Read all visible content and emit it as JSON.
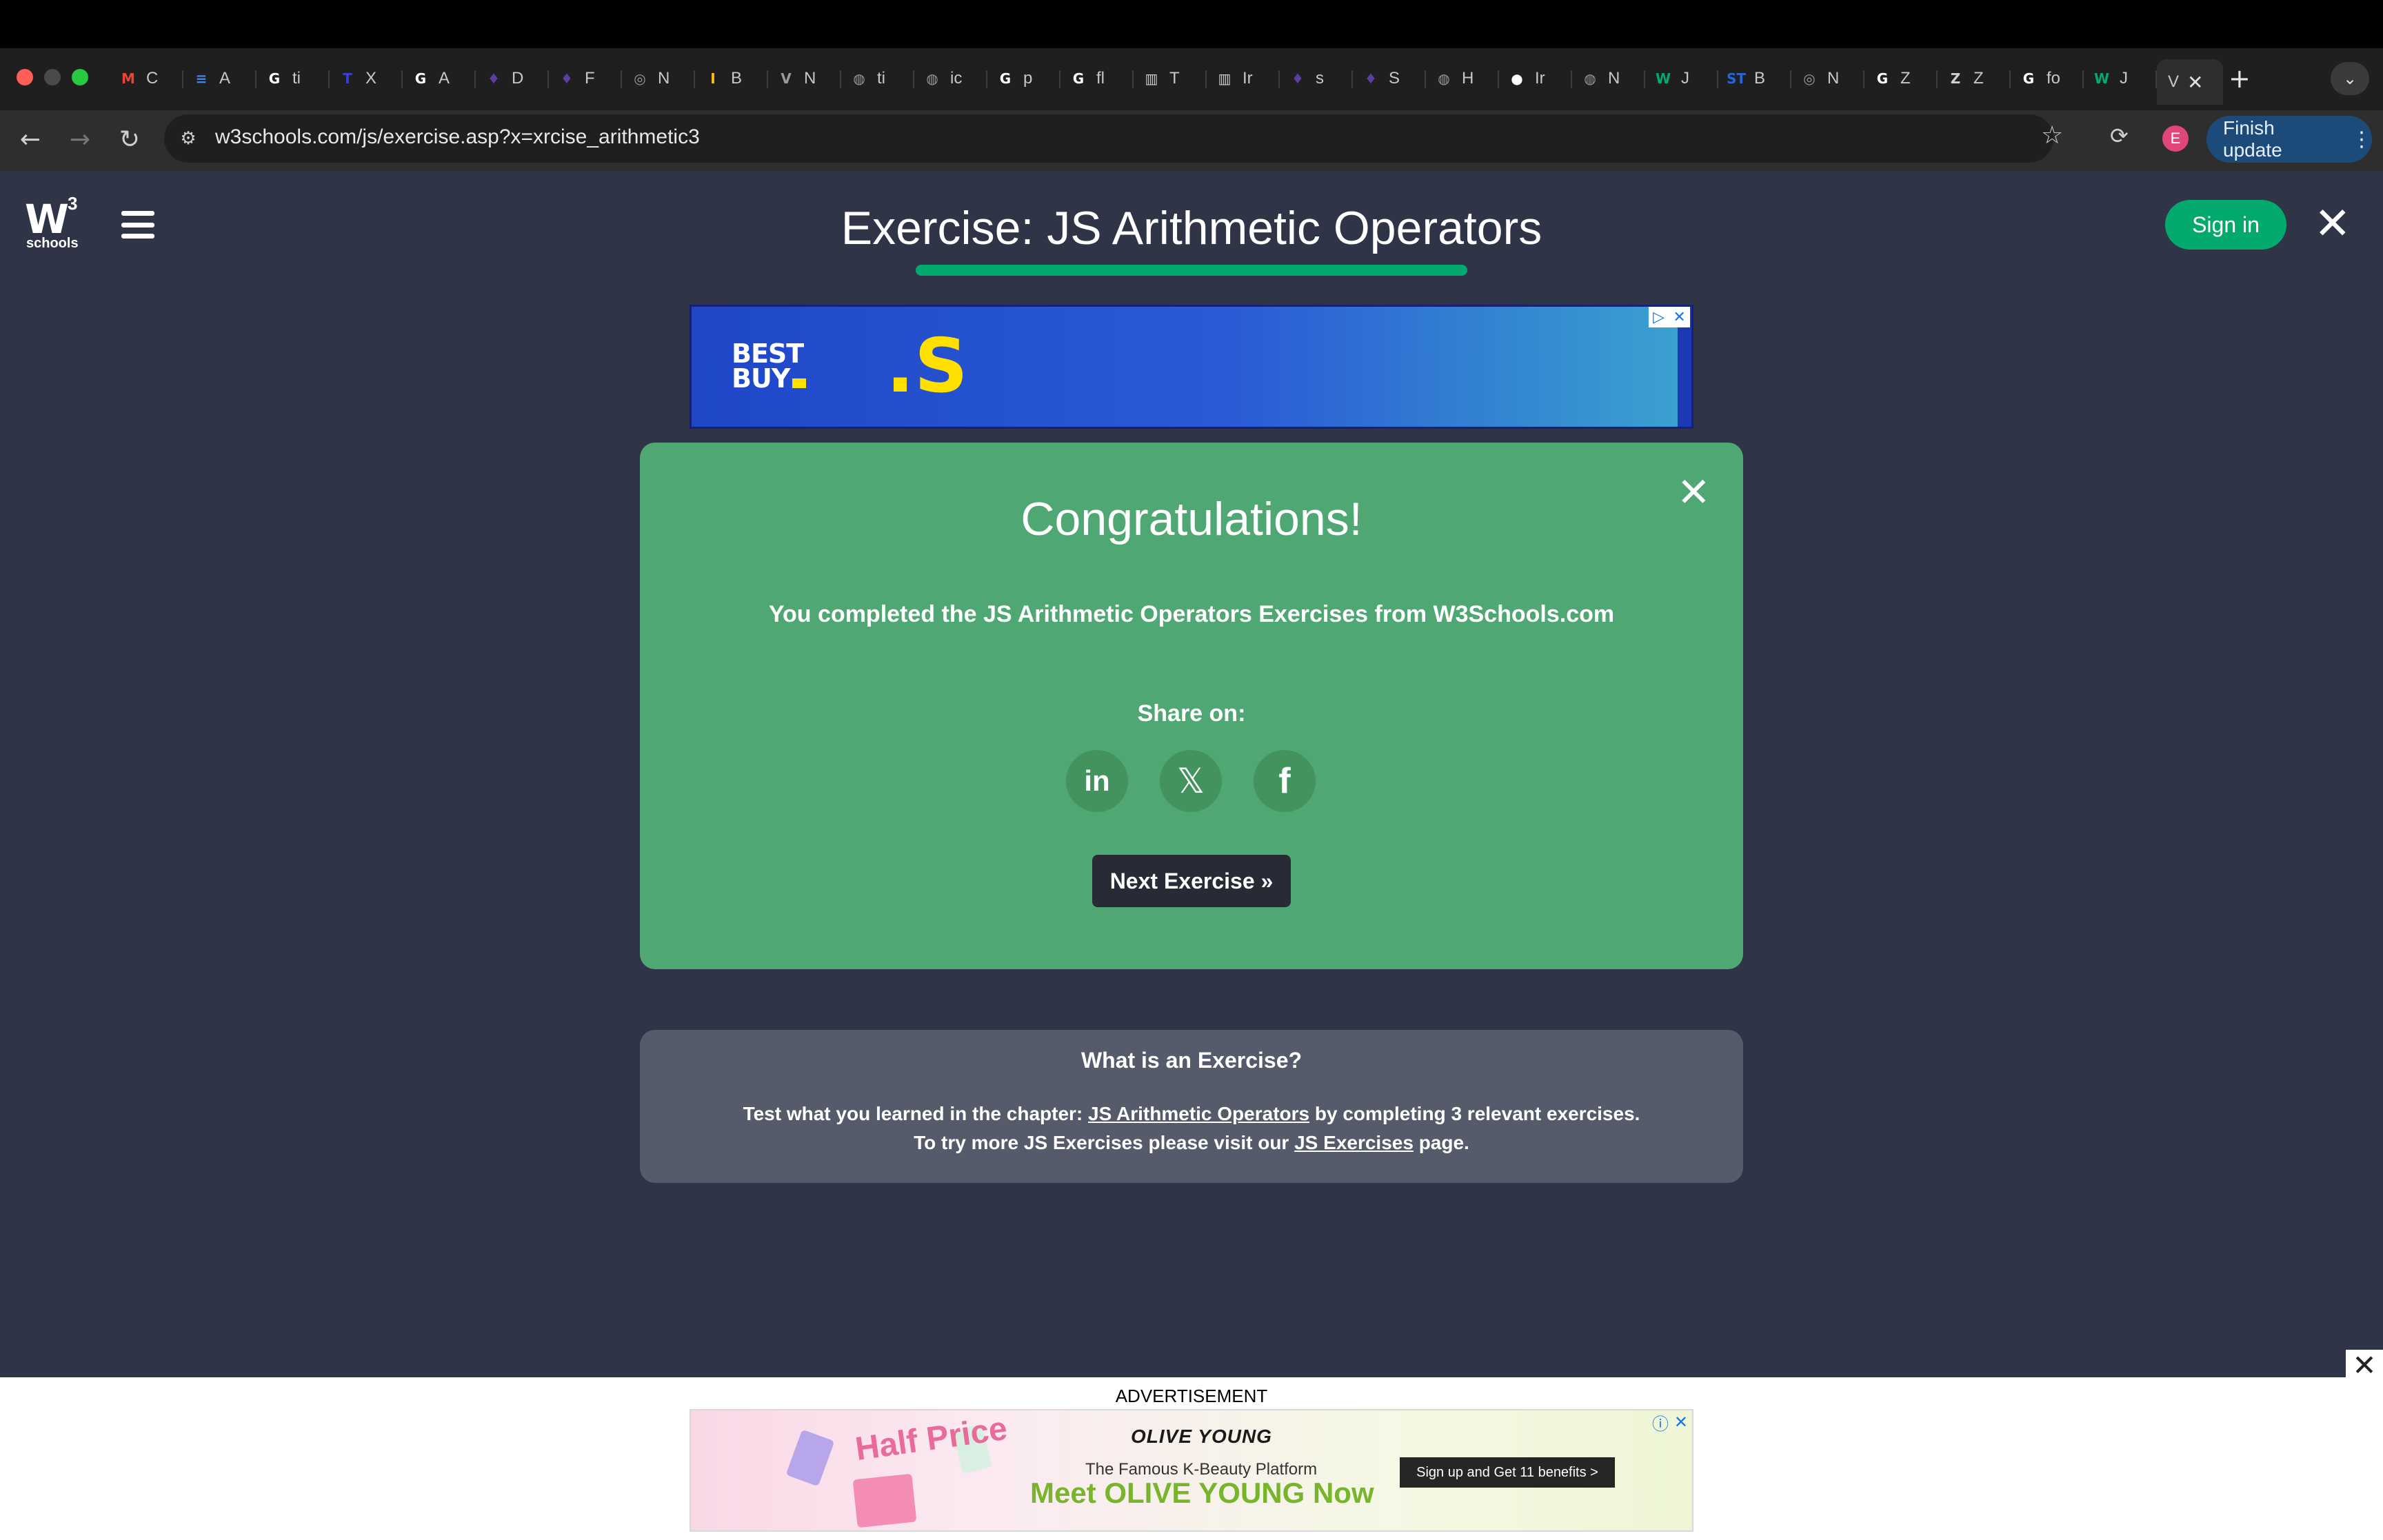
{
  "browser": {
    "tabs": [
      {
        "icon": "gmail-icon",
        "glyph": "M",
        "label": "C",
        "color": "#ea4335"
      },
      {
        "icon": "docs-icon",
        "glyph": "≡",
        "label": "A",
        "color": "#4285f4"
      },
      {
        "icon": "google-icon",
        "glyph": "G",
        "label": "ti",
        "color": "#ffffff"
      },
      {
        "icon": "t-icon",
        "glyph": "T",
        "label": "X",
        "color": "#3b3fd8"
      },
      {
        "icon": "google-icon",
        "glyph": "G",
        "label": "A",
        "color": "#ffffff"
      },
      {
        "icon": "tool-icon",
        "glyph": "♦",
        "label": "D",
        "color": "#5b3fa0"
      },
      {
        "icon": "tool-icon",
        "glyph": "♦",
        "label": "F",
        "color": "#5b3fa0"
      },
      {
        "icon": "chrome-icon",
        "glyph": "◎",
        "label": "N",
        "color": "#9a9a9a"
      },
      {
        "icon": "i-icon",
        "glyph": "I",
        "label": "B",
        "color": "#f5c518"
      },
      {
        "icon": "vercel-icon",
        "glyph": "V",
        "label": "N",
        "color": "#9a9a9a"
      },
      {
        "icon": "globe-icon",
        "glyph": "◍",
        "label": "ti",
        "color": "#9a9a9a"
      },
      {
        "icon": "globe-icon",
        "glyph": "◍",
        "label": "ic",
        "color": "#9a9a9a"
      },
      {
        "icon": "google-icon",
        "glyph": "G",
        "label": "p",
        "color": "#ffffff"
      },
      {
        "icon": "google-icon",
        "glyph": "G",
        "label": "fl",
        "color": "#ffffff"
      },
      {
        "icon": "bank-icon",
        "glyph": "▥",
        "label": "T",
        "color": "#d0d0d0"
      },
      {
        "icon": "bank-icon",
        "glyph": "▥",
        "label": "Ir",
        "color": "#d0d0d0"
      },
      {
        "icon": "tool-icon",
        "glyph": "♦",
        "label": "s",
        "color": "#5b3fa0"
      },
      {
        "icon": "tool-icon",
        "glyph": "♦",
        "label": "S",
        "color": "#5b3fa0"
      },
      {
        "icon": "globe-icon",
        "glyph": "◍",
        "label": "H",
        "color": "#9a9a9a"
      },
      {
        "icon": "github-icon",
        "glyph": "●",
        "label": "Ir",
        "color": "#ffffff"
      },
      {
        "icon": "globe-icon",
        "glyph": "◍",
        "label": "N",
        "color": "#9a9a9a"
      },
      {
        "icon": "w3-icon",
        "glyph": "W",
        "label": "J",
        "color": "#04aa6d"
      },
      {
        "icon": "st-icon",
        "glyph": "ST",
        "label": "B",
        "color": "#2a64d8"
      },
      {
        "icon": "chrome-icon",
        "glyph": "◎",
        "label": "N",
        "color": "#9a9a9a"
      },
      {
        "icon": "google-icon",
        "glyph": "G",
        "label": "Z",
        "color": "#ffffff"
      },
      {
        "icon": "z-icon",
        "glyph": "Z",
        "label": "Z",
        "color": "#d0d0d0"
      },
      {
        "icon": "google-icon",
        "glyph": "G",
        "label": "fo",
        "color": "#ffffff"
      },
      {
        "icon": "w3-icon",
        "glyph": "W",
        "label": "J",
        "color": "#04aa6d"
      }
    ],
    "active_tab": {
      "label": "V",
      "close": "✕"
    },
    "new_tab": "+",
    "tab_search": "⌄",
    "url": "w3schools.com/js/exercise.asp?x=xrcise_arithmetic3",
    "profile_initial": "E",
    "update_label": "Finish update",
    "update_menu": "⋮"
  },
  "site": {
    "logo_text": "W",
    "logo_superscript": "3",
    "logo_sub": "schools",
    "title": "Exercise: JS Arithmetic Operators",
    "sign_in": "Sign in",
    "close": "✕"
  },
  "ad_top": {
    "brand": "BEST BUY.",
    "brand_line1": "BEST",
    "brand_line2": "BUY",
    "glyph": ".S"
  },
  "congrats": {
    "title": "Congratulations!",
    "message": "You completed the JS Arithmetic Operators Exercises from W3Schools.com",
    "share_label": "Share on:",
    "share": {
      "linkedin": "in",
      "x": "𝕏",
      "facebook": "f"
    },
    "next_button": "Next Exercise »",
    "close": "✕"
  },
  "info": {
    "title": "What is an Exercise?",
    "line1_prefix": "Test what you learned in the chapter: ",
    "line1_link": "JS Arithmetic Operators",
    "line1_suffix": " by completing 3 relevant exercises.",
    "line2_prefix": "To try more JS Exercises please visit our ",
    "line2_link": "JS Exercises",
    "line2_suffix": " page."
  },
  "ad_bottom": {
    "label": "ADVERTISEMENT",
    "close": "✕",
    "promo": "Half Price",
    "brand": "OLIVE YOUNG",
    "subtitle": "The Famous K-Beauty Platform",
    "headline": "Meet OLIVE YOUNG Now",
    "cta": "Sign up and Get 11 benefits  >"
  }
}
